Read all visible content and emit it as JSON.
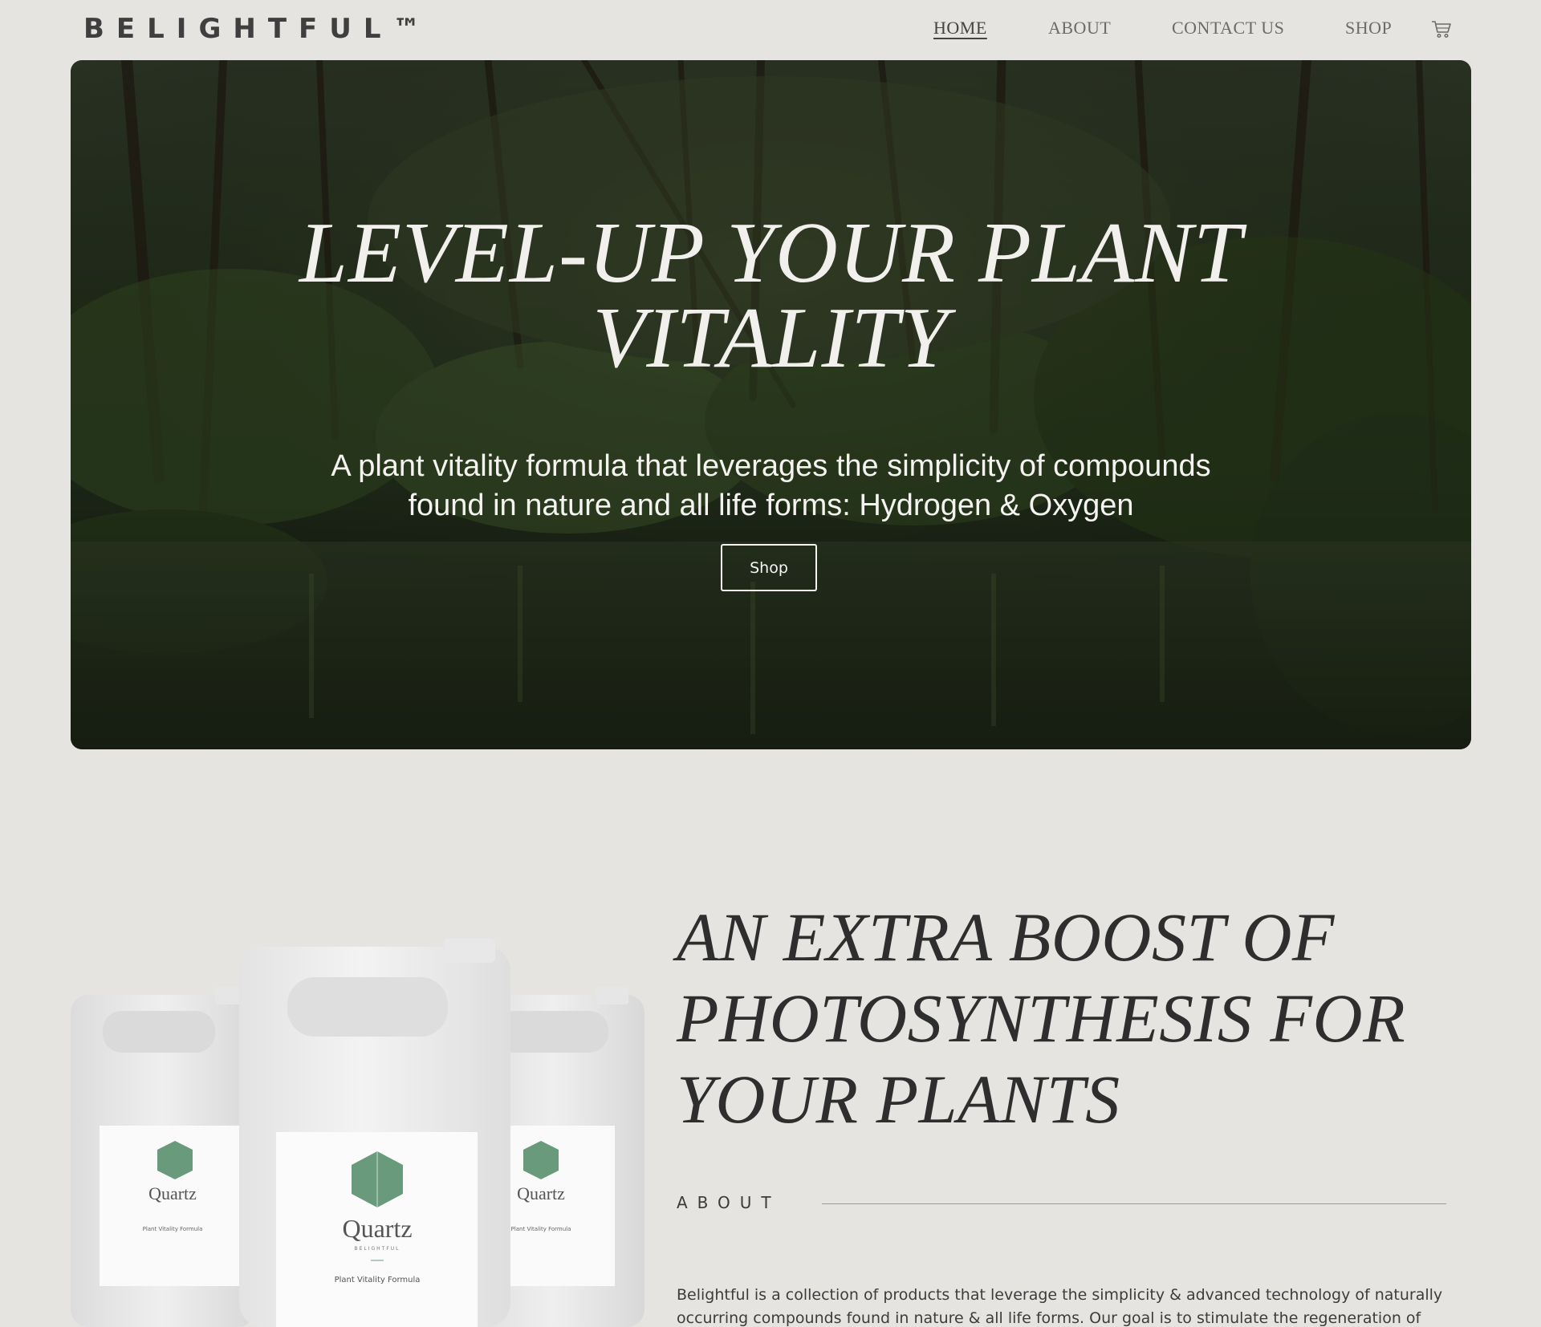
{
  "header": {
    "logo": "BELIGHTFUL™",
    "nav": {
      "home": "HOME",
      "about": "ABOUT",
      "contact": "CONTACT US",
      "shop": "SHOP"
    },
    "cart_icon": "cart-icon"
  },
  "hero": {
    "title_line1": "LEVEL-UP YOUR PLANT",
    "title_line2": "VITALITY",
    "subtitle_line1": "A plant vitality formula that leverages the simplicity of compounds",
    "subtitle_line2": "found in nature and all life forms: Hydrogen & Oxygen",
    "button_label": "Shop"
  },
  "products": {
    "brand": "Quartz",
    "sub_brand": "BELIGHTFUL",
    "product_name": "Plant Vitality Formula"
  },
  "about": {
    "heading_line1": "AN EXTRA BOOST OF",
    "heading_line2": "PHOTOSYNTHESIS FOR",
    "heading_line3": "YOUR PLANTS",
    "label": "ABOUT",
    "body_line1": "Belightful is a collection of products that leverage the simplicity & advanced technology of naturally",
    "body_line2": "occurring compounds found in nature & all life forms. Our goal is to stimulate the regeneration of plants,"
  },
  "colors": {
    "page_bg": "#e5e4e1",
    "label_green": "#6a9a7c",
    "text_dark": "#2e2e2e"
  }
}
